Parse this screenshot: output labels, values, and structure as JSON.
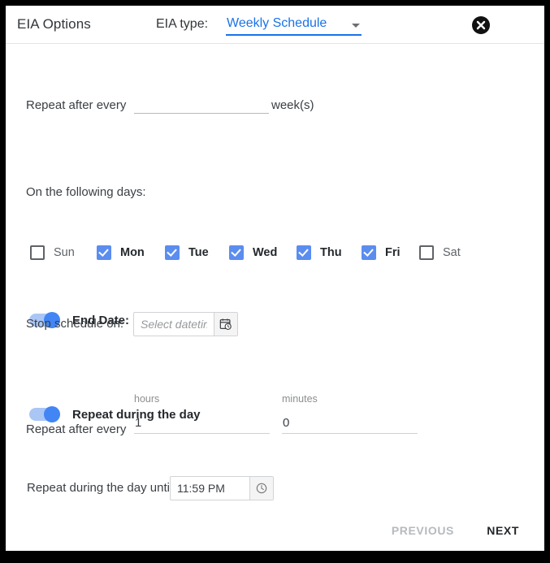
{
  "header": {
    "title": "EIA Options",
    "eia_type_label": "EIA type:",
    "eia_type_value": "Weekly Schedule",
    "caret_icon": "chevron-down-icon",
    "close_icon": "close-circle-icon"
  },
  "weekly": {
    "repeat_after_every_label": "Repeat after every",
    "weeks_value": "",
    "weeks_placeholder": "",
    "weeks_unit_label": "week(s)",
    "following_days_label": "On the following days:",
    "days": [
      {
        "label": "Sun",
        "checked": false
      },
      {
        "label": "Mon",
        "checked": true
      },
      {
        "label": "Tue",
        "checked": true
      },
      {
        "label": "Wed",
        "checked": true
      },
      {
        "label": "Thu",
        "checked": true
      },
      {
        "label": "Fri",
        "checked": true
      },
      {
        "label": "Sat",
        "checked": false
      }
    ]
  },
  "end_date": {
    "toggle_label": "End Date:",
    "toggle_on": true,
    "stop_schedule_label": "Stop schedule on:",
    "datetime_value": "",
    "datetime_placeholder": "Select datetime",
    "datetime_icon": "calendar-clock-icon"
  },
  "repeat_during_day": {
    "toggle_label": "Repeat during the day",
    "toggle_on": true,
    "repeat_after_every_label": "Repeat after every",
    "hours_caption": "hours",
    "hours_value": "1",
    "minutes_caption": "minutes",
    "minutes_value": "0",
    "until_label": "Repeat during the day until:",
    "until_value": "11:59 PM",
    "until_icon": "clock-icon"
  },
  "footer": {
    "previous_label": "PREVIOUS",
    "next_label": "NEXT"
  },
  "colors": {
    "accent_blue": "#1a73e8",
    "checkbox_blue": "#5b8def",
    "toggle_knob": "#4285f4",
    "toggle_track": "#aac6f5",
    "text_primary": "#24282c",
    "text_secondary": "#5f6368",
    "disabled": "#b7babd",
    "border": "#d0d3d6"
  }
}
